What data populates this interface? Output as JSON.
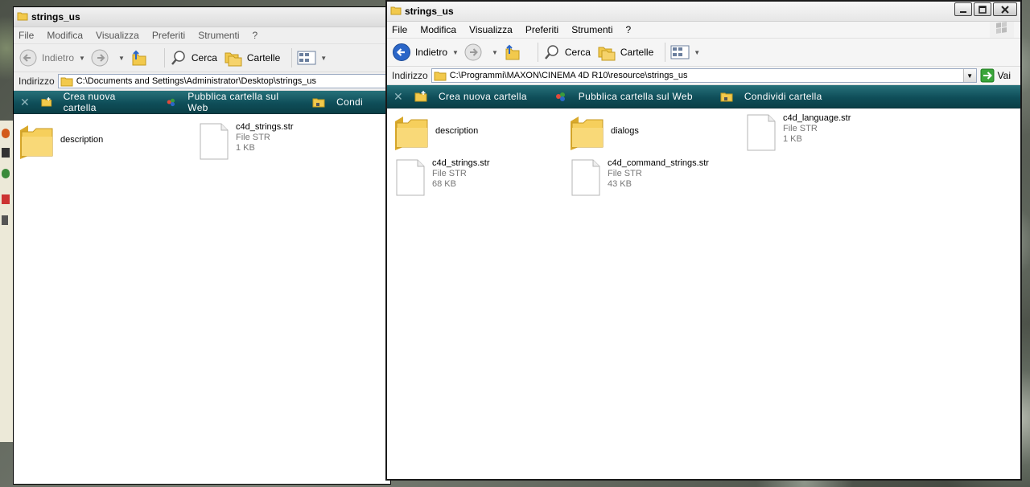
{
  "left_window": {
    "title": "strings_us",
    "menu": [
      "File",
      "Modifica",
      "Visualizza",
      "Preferiti",
      "Strumenti",
      "?"
    ],
    "toolbar": {
      "back": "Indietro",
      "search": "Cerca",
      "folders": "Cartelle"
    },
    "address": {
      "label": "Indirizzo",
      "path": "C:\\Documents and Settings\\Administrator\\Desktop\\strings_us"
    },
    "tasks": [
      "Crea nuova cartella",
      "Pubblica cartella sul Web",
      "Condi"
    ],
    "items": [
      {
        "name": "description",
        "kind": "folder"
      },
      {
        "name": "c4d_strings.str",
        "type": "File STR",
        "size": "1 KB",
        "kind": "file"
      }
    ]
  },
  "right_window": {
    "title": "strings_us",
    "menu": [
      "File",
      "Modifica",
      "Visualizza",
      "Preferiti",
      "Strumenti",
      "?"
    ],
    "toolbar": {
      "back": "Indietro",
      "search": "Cerca",
      "folders": "Cartelle"
    },
    "address": {
      "label": "Indirizzo",
      "path": "C:\\Programmi\\MAXON\\CINEMA 4D R10\\resource\\strings_us",
      "go": "Vai"
    },
    "tasks": [
      "Crea nuova cartella",
      "Pubblica cartella sul Web",
      "Condividi cartella"
    ],
    "items": [
      {
        "name": "description",
        "kind": "folder"
      },
      {
        "name": "dialogs",
        "kind": "folder"
      },
      {
        "name": "c4d_language.str",
        "type": "File STR",
        "size": "1 KB",
        "kind": "file"
      },
      {
        "name": "c4d_strings.str",
        "type": "File STR",
        "size": "68 KB",
        "kind": "file"
      },
      {
        "name": "c4d_command_strings.str",
        "type": "File STR",
        "size": "43 KB",
        "kind": "file"
      }
    ]
  },
  "colors": {
    "taskbar": "#0f4e59",
    "folder": "#f2c94c",
    "accent": "#2b66c8"
  }
}
